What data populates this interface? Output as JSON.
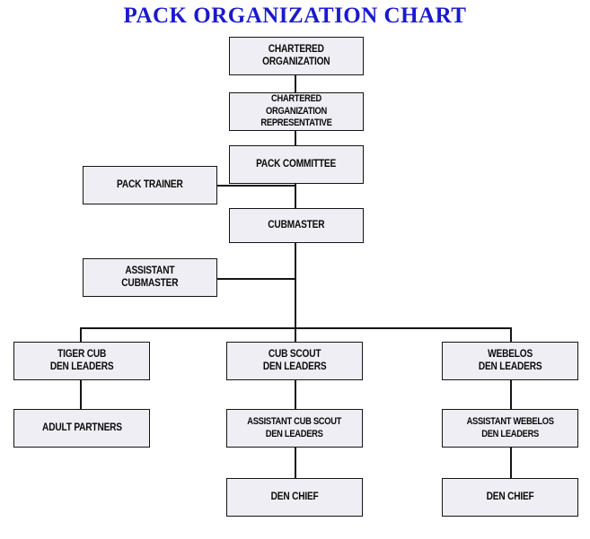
{
  "title": "PACK ORGANIZATION CHART",
  "colors": {
    "title": "#1a1acd",
    "box_fill": "#eeeef4",
    "box_border": "#141414",
    "connector": "#151515",
    "background": "#ffffff"
  },
  "nodes": {
    "chartered_organization": "CHARTERED\nORGANIZATION",
    "chartered_organization_representative": "CHARTERED ORGANIZATION\nREPRESENTATIVE",
    "pack_committee": "PACK COMMITTEE",
    "pack_trainer": "PACK TRAINER",
    "cubmaster": "CUBMASTER",
    "assistant_cubmaster": "ASSISTANT\nCUBMASTER",
    "tiger_cub_den_leaders": "TIGER CUB\nDEN LEADERS",
    "cub_scout_den_leaders": "CUB SCOUT\nDEN LEADERS",
    "webelos_den_leaders": "WEBELOS\nDEN LEADERS",
    "adult_partners": "ADULT PARTNERS",
    "assistant_cub_scout_den_leaders": "ASSISTANT CUB SCOUT\nDEN LEADERS",
    "assistant_webelos_den_leaders": "ASSISTANT WEBELOS\nDEN LEADERS",
    "den_chief_cub_scout": "DEN CHIEF",
    "den_chief_webelos": "DEN CHIEF"
  },
  "chart_data": {
    "type": "diagram",
    "title": "PACK ORGANIZATION CHART",
    "diagram_kind": "organizational-hierarchy",
    "nodes": [
      {
        "id": "chartered_organization",
        "label": "CHARTERED ORGANIZATION",
        "level": 0,
        "column": "center"
      },
      {
        "id": "chartered_organization_representative",
        "label": "CHARTERED ORGANIZATION REPRESENTATIVE",
        "level": 1,
        "column": "center"
      },
      {
        "id": "pack_committee",
        "label": "PACK COMMITTEE",
        "level": 2,
        "column": "center"
      },
      {
        "id": "pack_trainer",
        "label": "PACK TRAINER",
        "level": 2,
        "column": "left"
      },
      {
        "id": "cubmaster",
        "label": "CUBMASTER",
        "level": 3,
        "column": "center"
      },
      {
        "id": "assistant_cubmaster",
        "label": "ASSISTANT CUBMASTER",
        "level": 4,
        "column": "left"
      },
      {
        "id": "tiger_cub_den_leaders",
        "label": "TIGER CUB DEN LEADERS",
        "level": 5,
        "column": "left"
      },
      {
        "id": "cub_scout_den_leaders",
        "label": "CUB SCOUT DEN LEADERS",
        "level": 5,
        "column": "center"
      },
      {
        "id": "webelos_den_leaders",
        "label": "WEBELOS DEN LEADERS",
        "level": 5,
        "column": "right"
      },
      {
        "id": "adult_partners",
        "label": "ADULT PARTNERS",
        "level": 6,
        "column": "left"
      },
      {
        "id": "assistant_cub_scout_den_leaders",
        "label": "ASSISTANT CUB SCOUT DEN LEADERS",
        "level": 6,
        "column": "center"
      },
      {
        "id": "assistant_webelos_den_leaders",
        "label": "ASSISTANT WEBELOS DEN LEADERS",
        "level": 6,
        "column": "right"
      },
      {
        "id": "den_chief_cub_scout",
        "label": "DEN CHIEF",
        "level": 7,
        "column": "center"
      },
      {
        "id": "den_chief_webelos",
        "label": "DEN CHIEF",
        "level": 7,
        "column": "right"
      }
    ],
    "edges": [
      {
        "from": "chartered_organization",
        "to": "chartered_organization_representative"
      },
      {
        "from": "chartered_organization_representative",
        "to": "pack_committee"
      },
      {
        "from": "pack_committee",
        "to": "cubmaster"
      },
      {
        "from": "pack_trainer",
        "to": "pack_committee",
        "style": "lateral"
      },
      {
        "from": "cubmaster",
        "to": "assistant_cubmaster",
        "style": "lateral"
      },
      {
        "from": "cubmaster",
        "to": "tiger_cub_den_leaders"
      },
      {
        "from": "cubmaster",
        "to": "cub_scout_den_leaders"
      },
      {
        "from": "cubmaster",
        "to": "webelos_den_leaders"
      },
      {
        "from": "tiger_cub_den_leaders",
        "to": "adult_partners"
      },
      {
        "from": "cub_scout_den_leaders",
        "to": "assistant_cub_scout_den_leaders"
      },
      {
        "from": "webelos_den_leaders",
        "to": "assistant_webelos_den_leaders"
      },
      {
        "from": "assistant_cub_scout_den_leaders",
        "to": "den_chief_cub_scout"
      },
      {
        "from": "assistant_webelos_den_leaders",
        "to": "den_chief_webelos"
      }
    ]
  }
}
